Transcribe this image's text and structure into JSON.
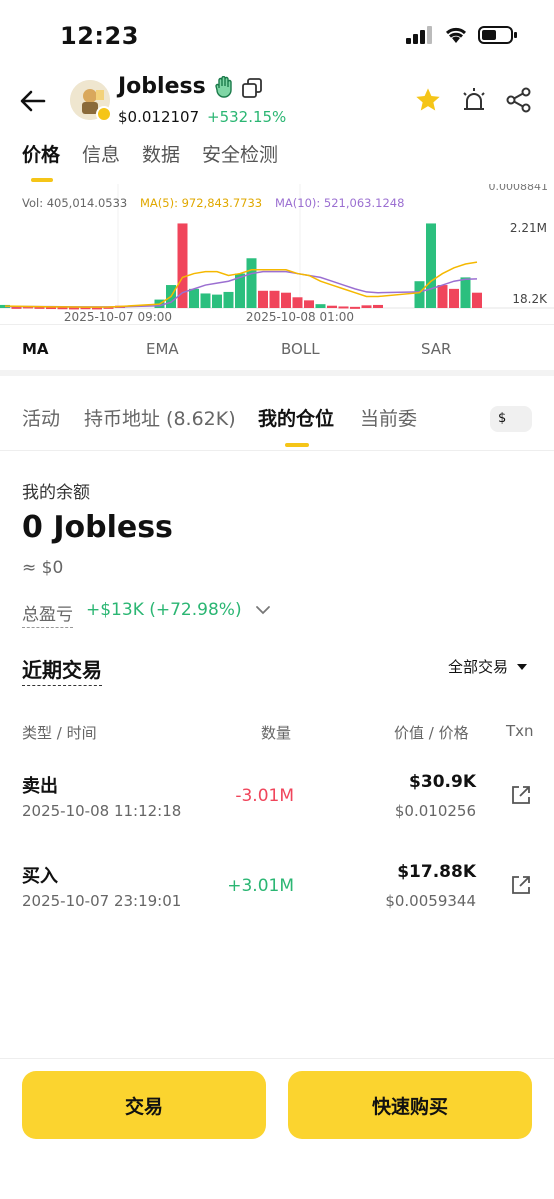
{
  "status": {
    "time": "12:23"
  },
  "header": {
    "name": "Jobless",
    "price": "$0.012107",
    "change": "+532.15%"
  },
  "tabs": [
    "价格",
    "信息",
    "数据",
    "安全检测"
  ],
  "chart": {
    "top_label": "0.0008841",
    "vol_label": "Vol: 405,014.0533",
    "ma5_label": "MA(5): 972,843.7733",
    "ma10_label": "MA(10): 521,063.1248",
    "y_high": "2.21M",
    "y_low": "18.2K",
    "x_ticks": [
      "2025-10-07 09:00",
      "2025-10-08 01:00"
    ],
    "colors": {
      "up": "#2bbf7e",
      "down": "#f0455b",
      "ma5": "#f5b800",
      "ma10": "#9b6fd1"
    }
  },
  "chart_data": {
    "type": "bar",
    "title": "",
    "ylim": [
      0,
      2300000
    ],
    "series": [
      {
        "name": "Vol",
        "values": [
          80000,
          30000,
          40000,
          30000,
          25000,
          20000,
          15000,
          20000,
          15000,
          30000,
          60000,
          220000,
          600000,
          2210000,
          500000,
          380000,
          350000,
          420000,
          900000,
          1300000,
          450000,
          450000,
          400000,
          280000,
          200000,
          100000,
          60000,
          40000,
          30000,
          70000,
          80000,
          700000,
          2210000,
          600000,
          500000,
          800000,
          400000
        ]
      },
      {
        "name": "MA(5)",
        "values": [
          50000,
          45000,
          40000,
          35000,
          30000,
          28000,
          25000,
          24000,
          22000,
          25000,
          40000,
          100000,
          300000,
          800000,
          900000,
          950000,
          950000,
          850000,
          900000,
          1000000,
          1000000,
          1000000,
          1000000,
          900000,
          850000,
          700000,
          600000,
          500000,
          400000,
          300000,
          300000,
          400000,
          700000,
          900000,
          1050000,
          1150000,
          1200000
        ]
      },
      {
        "name": "MA(10)",
        "values": [
          40000,
          40000,
          38000,
          37000,
          35000,
          33000,
          30000,
          30000,
          28000,
          28000,
          30000,
          60000,
          150000,
          400000,
          500000,
          600000,
          650000,
          700000,
          800000,
          900000,
          950000,
          950000,
          950000,
          900000,
          850000,
          800000,
          700000,
          600000,
          500000,
          420000,
          400000,
          420000,
          500000,
          600000,
          700000,
          750000,
          760000
        ]
      }
    ]
  },
  "indicators": [
    "MA",
    "EMA",
    "BOLL",
    "SAR"
  ],
  "sub_tabs": [
    "活动",
    "持币地址 (8.62K)",
    "我的仓位",
    "当前委"
  ],
  "currency": "$",
  "balance": {
    "label": "我的余额",
    "value": "0 Jobless",
    "usd": "≈ $0",
    "pnl_label": "总盈亏",
    "pnl_value": "+$13K (+72.98%)"
  },
  "recent": {
    "title": "近期交易",
    "filter": "全部交易",
    "columns": [
      "类型 / 时间",
      "数量",
      "价值 / 价格",
      "Txn"
    ],
    "rows": [
      {
        "type": "卖出",
        "time": "2025-10-08 11:12:18",
        "qty": "-3.01M",
        "value": "$30.9K",
        "price": "$0.010256",
        "qty_color": "#f0455b"
      },
      {
        "type": "买入",
        "time": "2025-10-07 23:19:01",
        "qty": "+3.01M",
        "value": "$17.88K",
        "price": "$0.0059344",
        "qty_color": "#2bb673"
      }
    ]
  },
  "actions": {
    "trade": "交易",
    "quick_buy": "快速购买"
  }
}
